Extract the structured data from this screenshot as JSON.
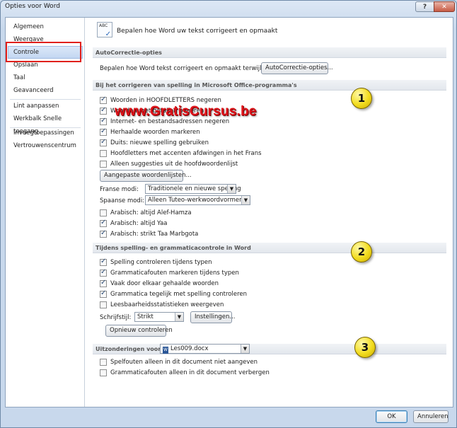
{
  "window": {
    "title": "Opties voor Word",
    "help_glyph": "?",
    "close_glyph": "✕"
  },
  "nav": {
    "items": [
      "Algemeen",
      "Weergave",
      "Controle",
      "Opslaan",
      "Taal",
      "Geavanceerd",
      "Lint aanpassen",
      "Werkbalk Snelle toegang",
      "Invoegtoepassingen",
      "Vertrouwenscentrum"
    ],
    "selected": "Controle"
  },
  "header": {
    "icon_text": "ABC",
    "text": "Bepalen hoe Word uw tekst corrigeert en opmaakt"
  },
  "autocorrect": {
    "section": "AutoCorrectie-opties",
    "label": "Bepalen hoe Word tekst corrigeert en opmaakt terwijl u typt:",
    "button": "AutoCorrectie-opties..."
  },
  "spelling_office": {
    "section": "Bij het corrigeren van spelling in Microsoft Office-programma's",
    "checkboxes": [
      {
        "label": "Woorden in HOOFDLETTERS negeren",
        "checked": true
      },
      {
        "label": "Woorden met getallen negeren",
        "checked": true
      },
      {
        "label": "Internet- en bestandsadressen negeren",
        "checked": true
      },
      {
        "label": "Herhaalde woorden markeren",
        "checked": true
      },
      {
        "label": "Duits: nieuwe spelling gebruiken",
        "checked": true
      },
      {
        "label": "Hoofdletters met accenten afdwingen in het Frans",
        "checked": false
      },
      {
        "label": "Alleen suggesties uit de hoofdwoordenlijst",
        "checked": false
      }
    ],
    "dict_button": "Aangepaste woordenlijsten...",
    "french_label": "Franse modi:",
    "french_value": "Traditionele en nieuwe spelling",
    "spanish_label": "Spaanse modi:",
    "spanish_value": "Alleen Tuteo-werkwoordvormen",
    "arabic": [
      {
        "label": "Arabisch: altijd Alef-Hamza",
        "checked": false
      },
      {
        "label": "Arabisch: altijd Yaa",
        "checked": true
      },
      {
        "label": "Arabisch: strikt Taa Marbgota",
        "checked": true
      }
    ]
  },
  "grammar_word": {
    "section": "Tijdens spelling- en grammaticacontrole in Word",
    "checkboxes": [
      {
        "label": "Spelling controleren tijdens typen",
        "checked": true
      },
      {
        "label": "Grammaticafouten markeren tijdens typen",
        "checked": true
      },
      {
        "label": "Vaak door elkaar gehaalde woorden",
        "checked": true
      },
      {
        "label": "Grammatica tegelijk met spelling controleren",
        "checked": true
      },
      {
        "label": "Leesbaarheidsstatistieken weergeven",
        "checked": false
      }
    ],
    "style_label": "Schrijfstijl:",
    "style_value": "Strikt",
    "settings_button": "Instellingen...",
    "recheck_button": "Opnieuw controleren"
  },
  "exceptions": {
    "label": "Uitzonderingen voor:",
    "doc_value": "Les009.docx",
    "checkboxes": [
      {
        "label": "Spelfouten alleen in dit document niet aangeven",
        "checked": false
      },
      {
        "label": "Grammaticafouten alleen in dit document verbergen",
        "checked": false
      }
    ]
  },
  "overlay": {
    "watermark": "www.GratisCursus.be",
    "badges": [
      "1",
      "2",
      "3"
    ],
    "highlight_color": "#e0201c",
    "badge_color": "#f2dc1e"
  },
  "footer": {
    "ok": "OK",
    "cancel": "Annuleren"
  }
}
